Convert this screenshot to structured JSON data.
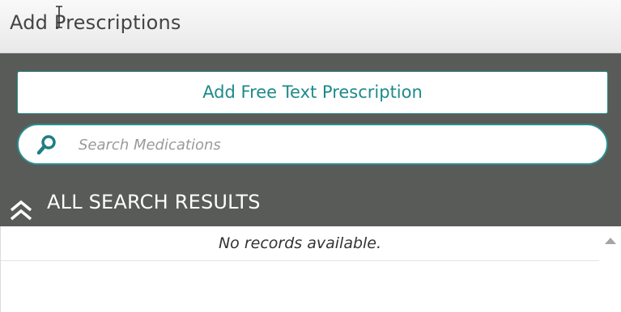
{
  "header": {
    "title": "Add Prescriptions"
  },
  "actions": {
    "free_text_label": "Add Free Text Prescription"
  },
  "search": {
    "placeholder": "Search Medications",
    "value": ""
  },
  "results": {
    "section_title": "ALL SEARCH RESULTS",
    "empty_message": "No records available."
  },
  "colors": {
    "accent": "#1e8a8a",
    "dark_panel": "#595b58",
    "header_bg": "#f0f0f0"
  },
  "icons": {
    "search": "search-icon",
    "collapse": "double-chevron-up-icon",
    "scroll_up": "scroll-up-arrow-icon",
    "cursor": "text-cursor-icon"
  }
}
